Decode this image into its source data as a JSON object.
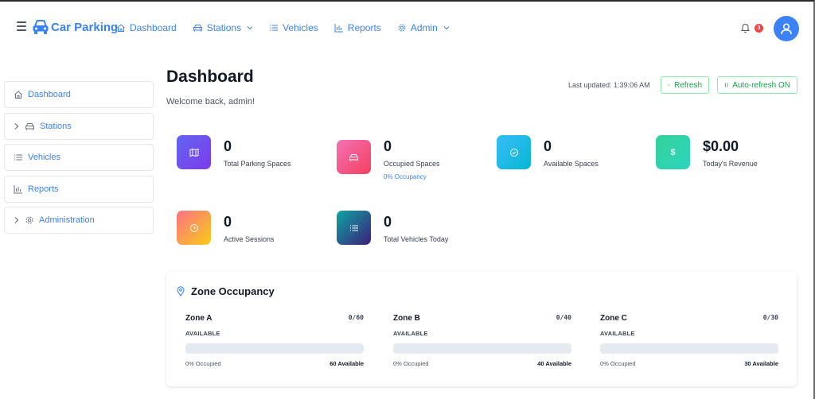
{
  "nav": {
    "brand": "Car Parking",
    "items": [
      {
        "label": "Dashboard"
      },
      {
        "label": "Stations"
      },
      {
        "label": "Vehicles"
      },
      {
        "label": "Reports"
      },
      {
        "label": "Admin"
      }
    ],
    "notification_count": "3"
  },
  "sidebar": {
    "items": [
      {
        "label": "Dashboard"
      },
      {
        "label": "Stations"
      },
      {
        "label": "Vehicles"
      },
      {
        "label": "Reports"
      },
      {
        "label": "Administration"
      }
    ]
  },
  "header": {
    "title": "Dashboard",
    "welcome": "Welcome back, admin!",
    "last_updated": "Last updated: 1:39:06 AM",
    "refresh_label": "Refresh",
    "auto_refresh_label": "Auto-refresh ON"
  },
  "stats": [
    {
      "value": "0",
      "label": "Total Parking Spaces",
      "icon": "map-icon",
      "gradient": [
        "#6366f1",
        "#7c3aed"
      ]
    },
    {
      "value": "0",
      "label": "Occupied Spaces",
      "sub": "0% Occupancy",
      "icon": "car-icon",
      "gradient": [
        "#f472b6",
        "#ef4444"
      ]
    },
    {
      "value": "0",
      "label": "Available Spaces",
      "icon": "check-circle-icon",
      "gradient": [
        "#38bdf8",
        "#06b6d4"
      ]
    },
    {
      "value": "$0.00",
      "label": "Today's Revenue",
      "icon": "dollar-icon",
      "gradient": [
        "#34d399",
        "#2dd4bf"
      ]
    },
    {
      "value": "0",
      "label": "Active Sessions",
      "icon": "clock-icon",
      "gradient": [
        "#fb7185",
        "#facc15"
      ]
    },
    {
      "value": "0",
      "label": "Total Vehicles Today",
      "icon": "list-icon",
      "gradient": [
        "#0ea5a4",
        "#3b1f7a"
      ]
    }
  ],
  "zones": {
    "title": "Zone Occupancy",
    "items": [
      {
        "name": "Zone A",
        "count": "0/60",
        "status": "AVAILABLE",
        "occupied": "0% Occupied",
        "available": "60 Available",
        "fill": 0
      },
      {
        "name": "Zone B",
        "count": "0/40",
        "status": "AVAILABLE",
        "occupied": "0% Occupied",
        "available": "40 Available",
        "fill": 0
      },
      {
        "name": "Zone C",
        "count": "0/30",
        "status": "AVAILABLE",
        "occupied": "0% Occupied",
        "available": "30 Available",
        "fill": 0
      }
    ]
  },
  "colors": {
    "primary": "#3b82f6",
    "success": "#16a34a",
    "danger": "#ef4444"
  }
}
